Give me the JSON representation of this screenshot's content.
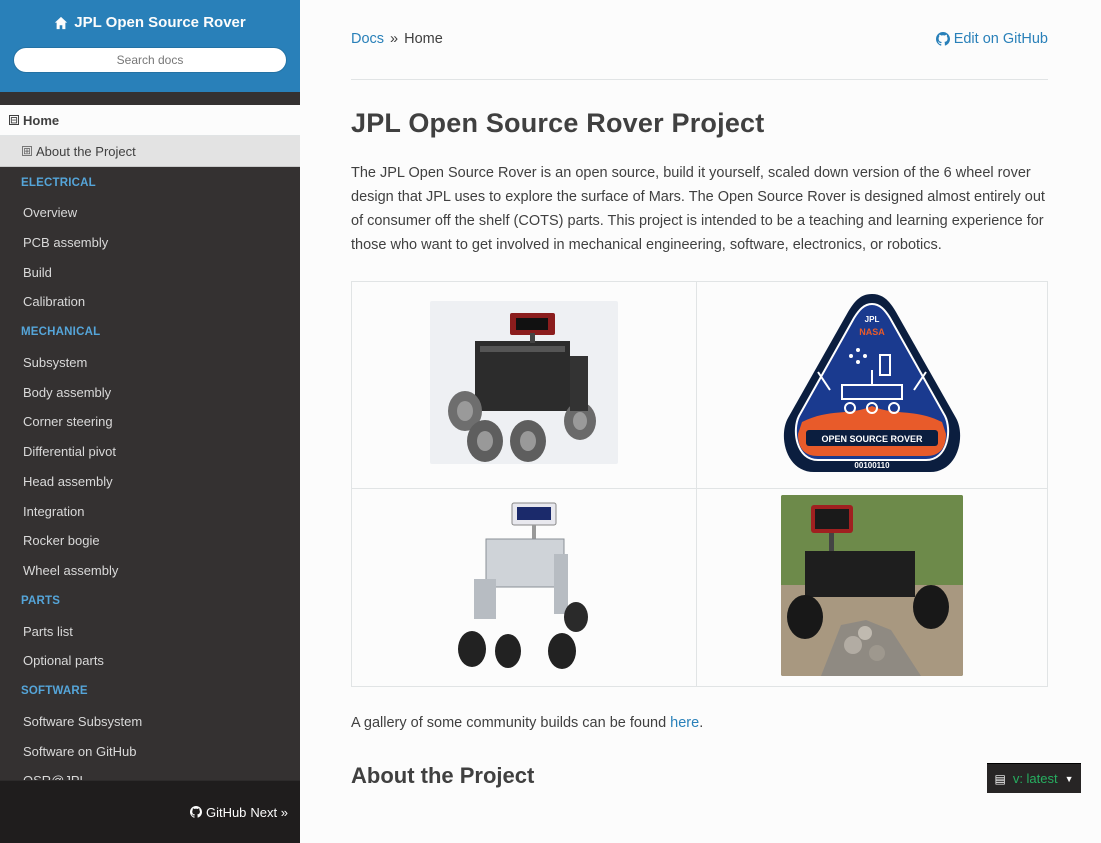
{
  "sidebar": {
    "project_title": "JPL Open Source Rover",
    "search_placeholder": "Search docs",
    "home": {
      "label": "Home",
      "toggle": "⊟"
    },
    "home_sub": {
      "label": "About the Project",
      "toggle": "⊞"
    },
    "sections": [
      {
        "caption": "ELECTRICAL",
        "items": [
          "Overview",
          "PCB assembly",
          "Build",
          "Calibration"
        ]
      },
      {
        "caption": "MECHANICAL",
        "items": [
          "Subsystem",
          "Body assembly",
          "Corner steering",
          "Differential pivot",
          "Head assembly",
          "Integration",
          "Rocker bogie",
          "Wheel assembly"
        ]
      },
      {
        "caption": "PARTS",
        "items": [
          "Parts list",
          "Optional parts"
        ]
      },
      {
        "caption": "SOFTWARE",
        "items": [
          "Software Subsystem",
          "Software on GitHub",
          "OSR@JPL"
        ]
      }
    ],
    "footer": {
      "github": "GitHub",
      "next": "Next »"
    }
  },
  "breadcrumb": {
    "docs": "Docs",
    "sep": "»",
    "current": "Home",
    "edit": "Edit on GitHub"
  },
  "page": {
    "title": "JPL Open Source Rover Project",
    "intro": "The JPL Open Source Rover is an open source, build it yourself, scaled down version of the 6 wheel rover design that JPL uses to explore the surface of Mars. The Open Source Rover is designed almost entirely out of consumer off the shelf (COTS) parts. This project is intended to be a teaching and learning experience for those who want to get involved in mechanical engineering, software, electronics, or robotics.",
    "gallery_text_pre": "A gallery of some community builds can be found ",
    "gallery_link": "here",
    "gallery_text_post": ".",
    "section2": "About the Project"
  },
  "logo": {
    "top": "JPL",
    "middle": "NASA",
    "band": "OPEN SOURCE ROVER",
    "code": "00100110"
  },
  "version": {
    "label": "v: latest"
  },
  "colors": {
    "accent": "#2980b9",
    "sidebar": "#343131",
    "caption": "#55a5d9",
    "version": "#27ae60"
  }
}
